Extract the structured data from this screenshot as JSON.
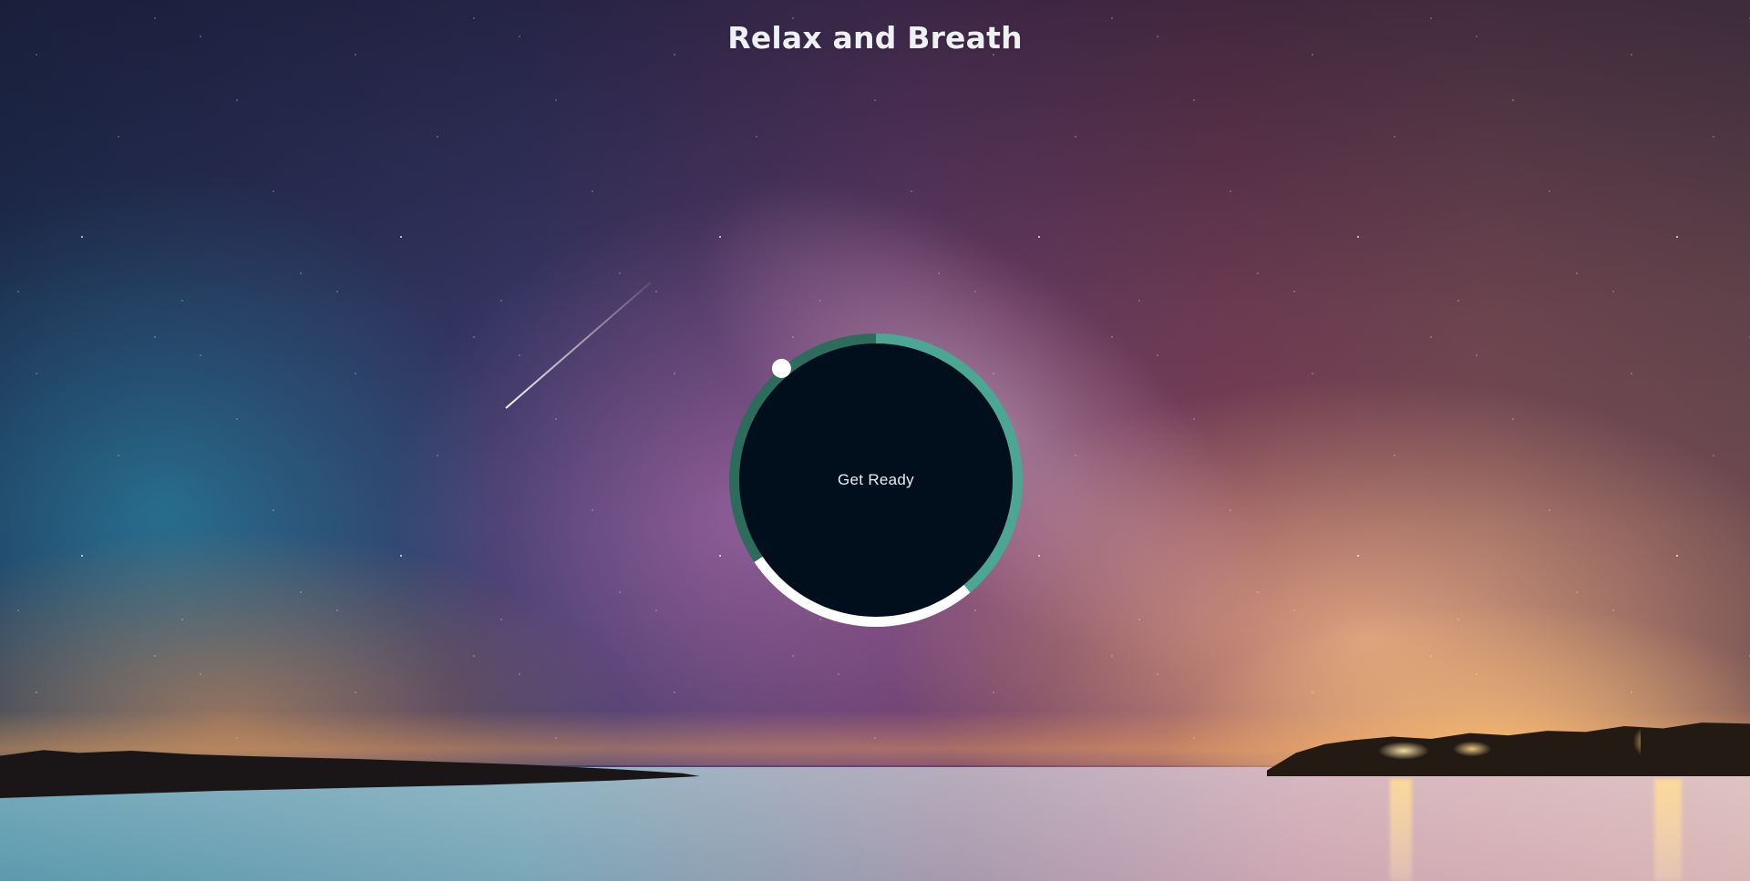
{
  "header": {
    "title": "Relax and Breath"
  },
  "breath_widget": {
    "status_text": "Get Ready",
    "colors": {
      "inhale_segment": "#4ba694",
      "hold_segment": "#ffffff",
      "exhale_segment": "#2d6b5c",
      "inner_circle": "#010f1c",
      "pointer": "#ffffff"
    },
    "icons": [
      "pointer-dot"
    ]
  },
  "background": {
    "scene": "night sky over sea"
  }
}
